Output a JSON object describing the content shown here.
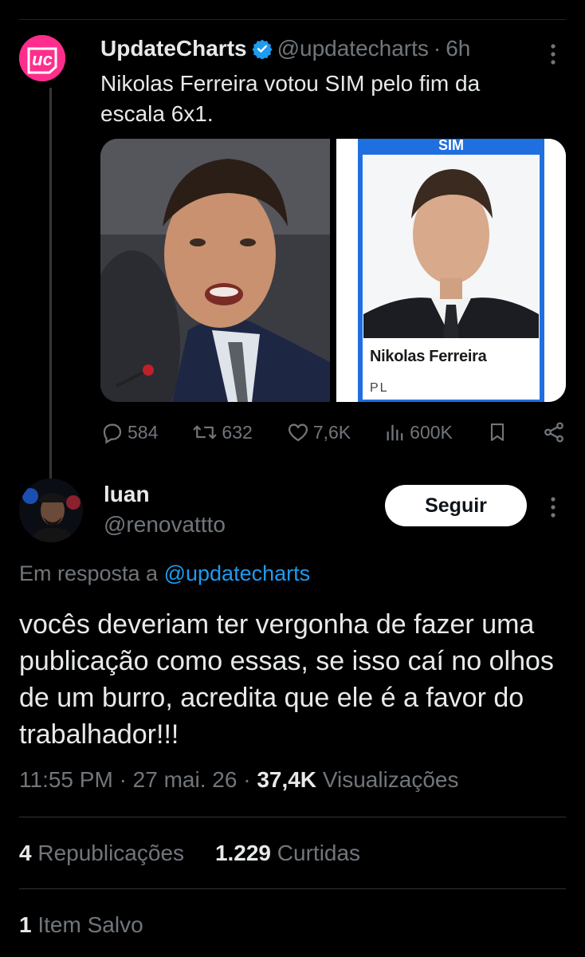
{
  "parent_tweet": {
    "avatar_text": "uc",
    "name": "UpdateCharts",
    "handle": "@updatecharts",
    "separator": "·",
    "time": "6h",
    "text": "Nikolas Ferreira votou SIM pelo fim da escala 6x1.",
    "media": {
      "right_header": "SIM",
      "right_caption_name": "Nikolas Ferreira",
      "right_caption_party": "PL"
    },
    "actions": {
      "replies": "584",
      "reposts": "632",
      "likes": "7,6K",
      "views": "600K"
    }
  },
  "reply_tweet": {
    "name": "luan",
    "handle": "@renovattto",
    "follow_label": "Seguir",
    "reply_to_prefix": "Em resposta a",
    "reply_to_handle": "@updatecharts",
    "text": "vocês deveriam ter vergonha de fazer uma publicação como essas, se isso caí no olhos de um burro, acredita que ele é a favor do trabalhador!!!",
    "time": "11:55 PM",
    "date": "27 mai. 26",
    "views_count": "37,4K",
    "views_label": "Visualizações",
    "reposts_count": "4",
    "reposts_label": "Republicações",
    "likes_count": "1.229",
    "likes_label": "Curtidas",
    "saved_count": "1",
    "saved_label": "Item Salvo"
  },
  "colors": {
    "background": "#000000",
    "text_primary": "#e7e9ea",
    "text_secondary": "#71767b",
    "accent_link": "#1d9bf0",
    "verified": "#1d9bf0",
    "brand_avatar": "#ff2e8d"
  },
  "icons": [
    "verified-badge-icon",
    "more-options-icon",
    "reply-icon",
    "repost-icon",
    "like-icon",
    "views-icon",
    "bookmark-icon",
    "share-icon"
  ]
}
